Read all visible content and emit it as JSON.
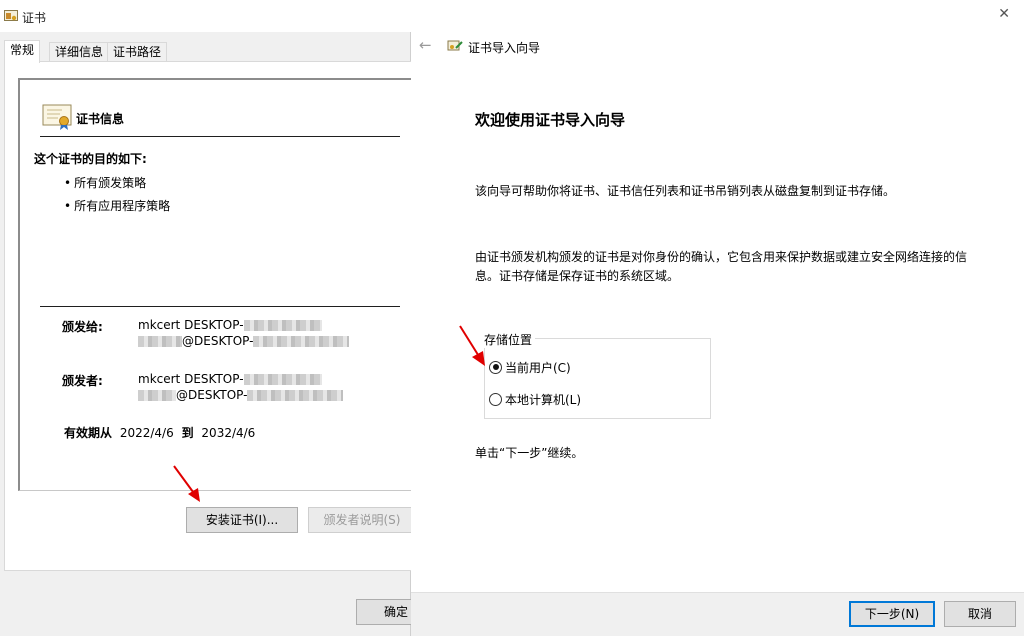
{
  "cert_dialog": {
    "title": "证书",
    "tabs": [
      "常规",
      "详细信息",
      "证书路径"
    ],
    "info_title": "证书信息",
    "purpose_title": "这个证书的目的如下:",
    "purposes": [
      "所有颁发策略",
      "所有应用程序策略"
    ],
    "issued_to_label": "颁发给:",
    "issued_to_line1": "mkcert DESKTOP-",
    "issued_to_line2": "@DESKTOP-",
    "issued_by_label": "颁发者:",
    "issued_by_line1": "mkcert DESKTOP-",
    "issued_by_line2": "@DESKTOP-",
    "valid_from_label": "有效期从",
    "valid_from": "2022/4/6",
    "valid_to_label": "到",
    "valid_to": "2032/4/6",
    "install_button": "安装证书(I)...",
    "issuer_statement_button": "颁发者说明(S)",
    "ok_button": "确定"
  },
  "wizard": {
    "title": "证书导入向导",
    "heading": "欢迎使用证书导入向导",
    "para1": "该向导可帮助你将证书、证书信任列表和证书吊销列表从磁盘复制到证书存储。",
    "para2_line1": "由证书颁发机构颁发的证书是对你身份的确认，它包含用来保护数据或建立安全网络连接的信",
    "para2_line2": "息。证书存储是保存证书的系统区域。",
    "store_location_label": "存储位置",
    "options": [
      {
        "label": "当前用户(C)",
        "checked": true
      },
      {
        "label": "本地计算机(L)",
        "checked": false
      }
    ],
    "continue_hint": "单击“下一步”继续。",
    "next_button": "下一步(N)",
    "cancel_button": "取消"
  },
  "colors": {
    "annotation_arrow": "#e00000",
    "primary_border": "#0078d7"
  },
  "icons": [
    "certificate-icon",
    "back-arrow-icon",
    "close-icon",
    "wizard-icon",
    "red-arrow-annotation"
  ]
}
